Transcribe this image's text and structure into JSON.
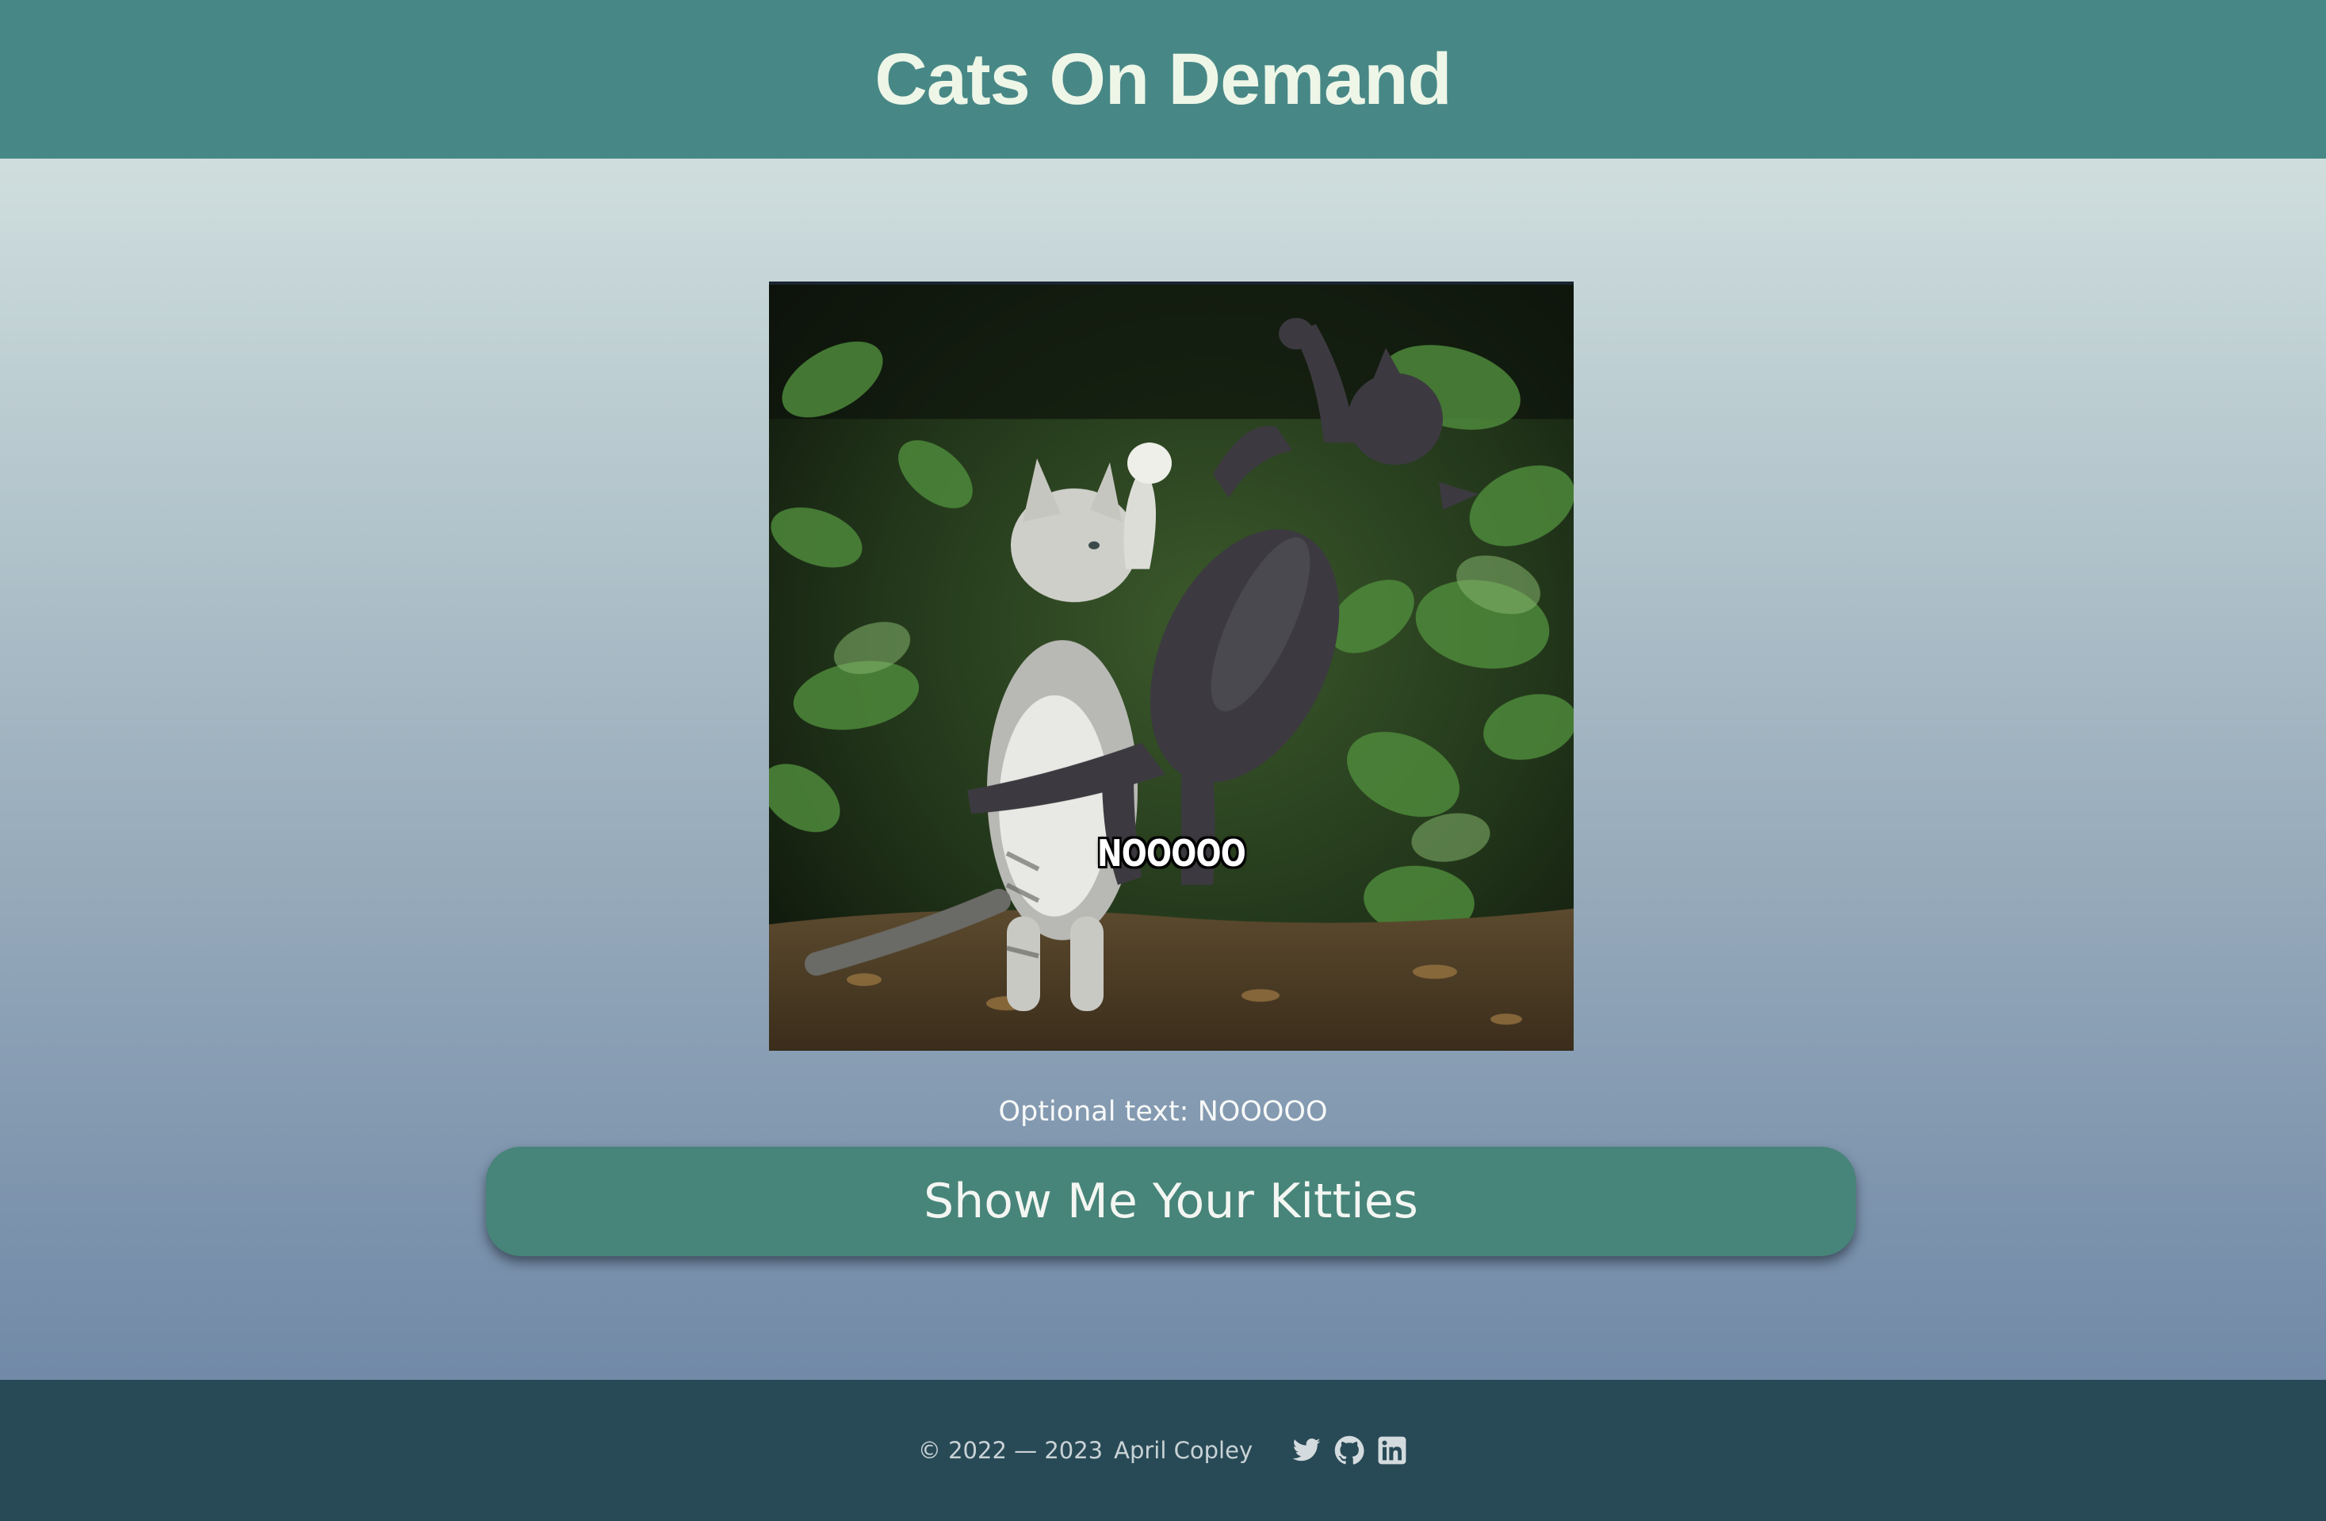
{
  "header": {
    "title": "Cats On Demand"
  },
  "image": {
    "overlay_text": "NOOOOO",
    "alt": "two kittens fighting"
  },
  "caption": {
    "text": "Optional text: NOOOOO"
  },
  "cta": {
    "label": "Show Me Your Kitties"
  },
  "footer": {
    "copyright": "© 2022 — 2023",
    "author": "April Copley",
    "social_icons": [
      "twitter-icon",
      "github-icon",
      "linkedin-icon"
    ]
  },
  "colors": {
    "header_bg": "#478886",
    "title_text": "#eef6e8",
    "button_bg": "#478479",
    "footer_bg": "#284a56"
  }
}
